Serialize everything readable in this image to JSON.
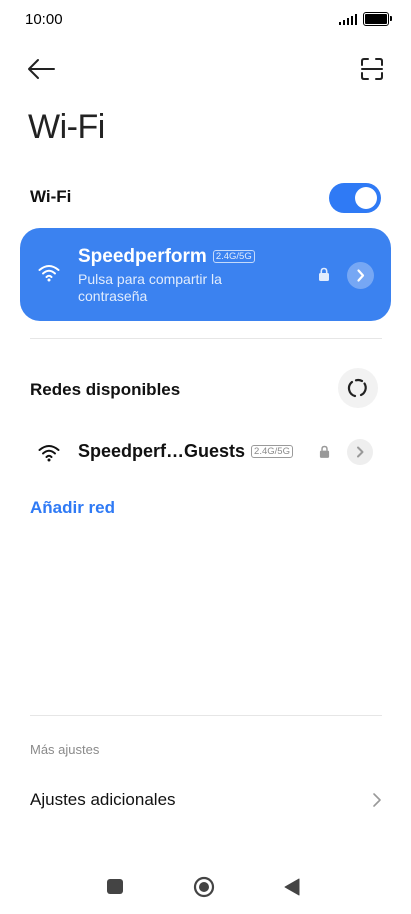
{
  "status_bar": {
    "time": "10:00",
    "signal_icon": "signal-icon",
    "battery_icon": "battery-icon"
  },
  "header": {
    "back_icon": "arrow-left-icon",
    "scan_icon": "qr-scan-icon"
  },
  "page_title": "Wi-Fi",
  "wifi_toggle": {
    "label": "Wi-Fi",
    "enabled": true
  },
  "connected_network": {
    "name": "Speedperform",
    "band": "2.4G/5G",
    "subtitle": "Pulsa para compartir la contraseña",
    "secured": true
  },
  "available": {
    "label": "Redes disponibles",
    "refresh_icon": "refresh-icon",
    "networks": [
      {
        "name": "Speedperf…Guests",
        "band": "2.4G/5G",
        "secured": true
      }
    ]
  },
  "add_network_label": "Añadir red",
  "more_settings": {
    "section_label": "Más ajustes",
    "items": [
      {
        "label": "Ajustes adicionales"
      }
    ]
  },
  "colors": {
    "accent": "#2f7af5",
    "card": "#3b82f0"
  },
  "nav_bar": {
    "recents_icon": "square-icon",
    "home_icon": "circle-icon",
    "back_icon": "triangle-back-icon"
  }
}
